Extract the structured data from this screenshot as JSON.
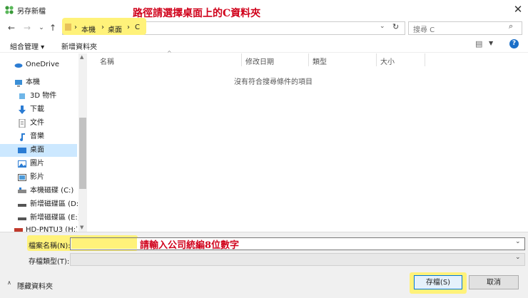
{
  "window": {
    "title": "另存新檔"
  },
  "annotations": {
    "path_hint": "路徑請選擇桌面上的C資料夾",
    "filename_hint": "請輸入公司統編8位數字"
  },
  "address": {
    "crumbs": [
      "本機",
      "桌面",
      "C"
    ]
  },
  "search": {
    "placeholder": "搜尋 C"
  },
  "toolbar": {
    "organize": "組合管理 ▾",
    "new_folder": "新增資料夾"
  },
  "sidebar": {
    "items": [
      {
        "label": "OneDrive",
        "icon": "cloud-icon"
      },
      {
        "label": "本機",
        "icon": "computer-icon"
      },
      {
        "label": "3D 物件",
        "icon": "cube-icon"
      },
      {
        "label": "下載",
        "icon": "download-arrow-icon"
      },
      {
        "label": "文件",
        "icon": "document-icon"
      },
      {
        "label": "音樂",
        "icon": "music-note-icon"
      },
      {
        "label": "桌面",
        "icon": "desktop-icon"
      },
      {
        "label": "圖片",
        "icon": "picture-icon"
      },
      {
        "label": "影片",
        "icon": "video-icon"
      },
      {
        "label": "本機磁碟 (C:)",
        "icon": "drive-icon"
      },
      {
        "label": "新增磁碟區 (D:)",
        "icon": "drive-icon"
      },
      {
        "label": "新增磁碟區 (E:)",
        "icon": "drive-icon"
      },
      {
        "label": "HD-PNTU3 (H:)",
        "icon": "usb-drive-icon"
      }
    ]
  },
  "columns": [
    "名稱",
    "修改日期",
    "類型",
    "大小"
  ],
  "empty_message": "沒有符合搜尋條件的項目",
  "form": {
    "filename_label": "檔案名稱(N):",
    "filename_value": "",
    "filetype_label": "存檔類型(T):",
    "filetype_value": ""
  },
  "footer": {
    "hide_folders": "隱藏資料夾"
  },
  "buttons": {
    "save": "存檔(S)",
    "cancel": "取消"
  },
  "colors": {
    "highlight": "#fff27a",
    "annotation": "#d0021b",
    "selection": "#cce8ff",
    "accent": "#0078d7"
  }
}
